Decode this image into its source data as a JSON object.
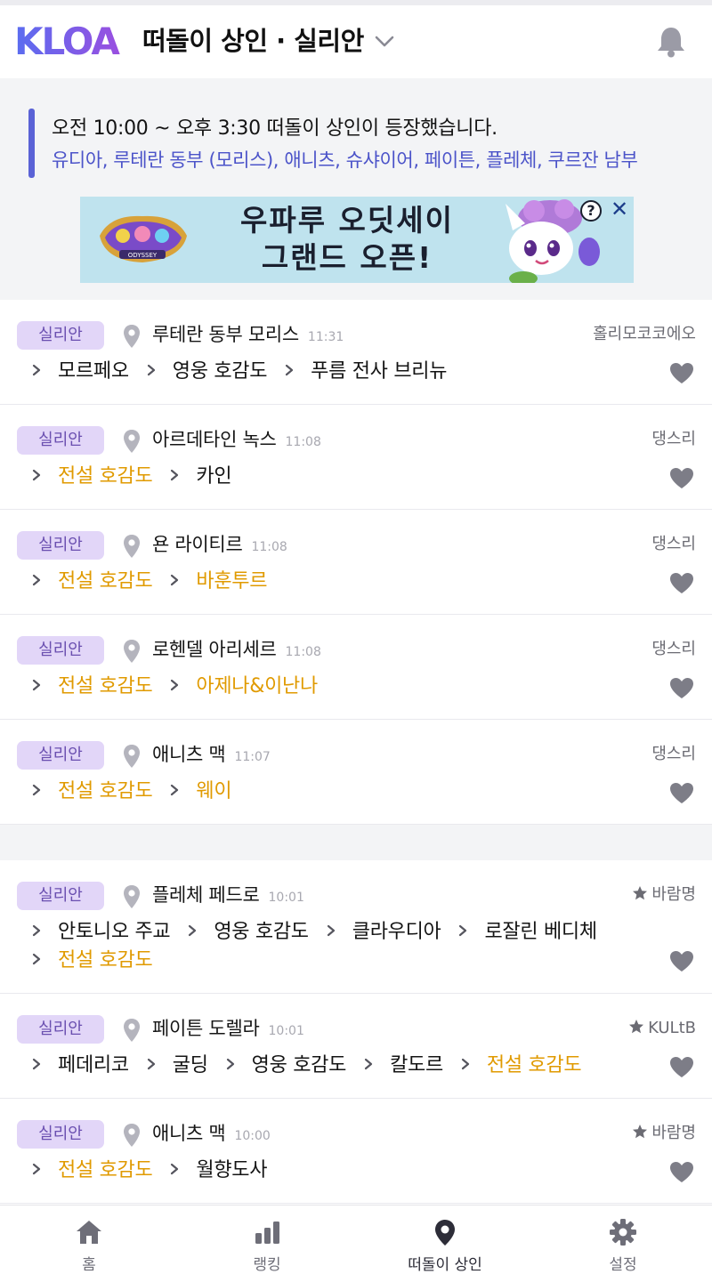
{
  "header": {
    "logo_text": "KLOA",
    "title": "떠돌이 상인 · 실리안",
    "logo_colors": [
      "#5a6df0",
      "#9a4fe0"
    ]
  },
  "notice": {
    "line1": "오전 10:00 ~ 오후 3:30 떠돌이 상인이 등장했습니다.",
    "line2": "유디아, 루테란 동부 (모리스), 애니츠, 슈샤이어, 페이튼, 플레체, 쿠르잔 남부"
  },
  "ad": {
    "text_line1": "우파루 오딧세이",
    "text_line2": "그랜드 오픈!",
    "info_label": "?",
    "close_label": "✕",
    "game_logo_text": "ODYSSEY"
  },
  "colors": {
    "accent": "#5a62d6",
    "badge_bg": "#e2d6f8",
    "badge_text": "#6a4fb0",
    "gold_item": "#e09a00",
    "icon_gray": "#9b9ba6"
  },
  "merchants_recent": [
    {
      "server": "실리안",
      "location": "루테란 동부 모리스",
      "time": "11:31",
      "user": "홀리모코코에오",
      "starred": false,
      "route": [
        {
          "name": "모르페오",
          "legendary": false
        },
        {
          "name": "영웅 호감도",
          "legendary": false
        },
        {
          "name": "푸름 전사 브리뉴",
          "legendary": false
        }
      ]
    },
    {
      "server": "실리안",
      "location": "아르데타인 녹스",
      "time": "11:08",
      "user": "댕스리",
      "starred": false,
      "route": [
        {
          "name": "전설 호감도",
          "legendary": true
        },
        {
          "name": "카인",
          "legendary": false
        }
      ]
    },
    {
      "server": "실리안",
      "location": "욘 라이티르",
      "time": "11:08",
      "user": "댕스리",
      "starred": false,
      "route": [
        {
          "name": "전설 호감도",
          "legendary": true
        },
        {
          "name": "바훈투르",
          "legendary": true
        }
      ]
    },
    {
      "server": "실리안",
      "location": "로헨델 아리세르",
      "time": "11:08",
      "user": "댕스리",
      "starred": false,
      "route": [
        {
          "name": "전설 호감도",
          "legendary": true
        },
        {
          "name": "아제나&이난나",
          "legendary": true
        }
      ]
    },
    {
      "server": "실리안",
      "location": "애니츠 맥",
      "time": "11:07",
      "user": "댕스리",
      "starred": false,
      "route": [
        {
          "name": "전설 호감도",
          "legendary": true
        },
        {
          "name": "웨이",
          "legendary": true
        }
      ]
    }
  ],
  "merchants_earlier": [
    {
      "server": "실리안",
      "location": "플레체 페드로",
      "time": "10:01",
      "user": "바람명",
      "starred": true,
      "route": [
        {
          "name": "안토니오 주교",
          "legendary": false
        },
        {
          "name": "영웅 호감도",
          "legendary": false
        },
        {
          "name": "클라우디아",
          "legendary": false
        },
        {
          "name": "로잘린 베디체",
          "legendary": false
        },
        {
          "name": "전설 호감도",
          "legendary": true
        }
      ]
    },
    {
      "server": "실리안",
      "location": "페이튼 도렐라",
      "time": "10:01",
      "user": "KULtB",
      "starred": true,
      "route": [
        {
          "name": "페데리코",
          "legendary": false
        },
        {
          "name": "굴딩",
          "legendary": false
        },
        {
          "name": "영웅 호감도",
          "legendary": false
        },
        {
          "name": "칼도르",
          "legendary": false
        },
        {
          "name": "전설 호감도",
          "legendary": true
        }
      ]
    },
    {
      "server": "실리안",
      "location": "애니츠 맥",
      "time": "10:00",
      "user": "바람명",
      "starred": true,
      "route": [
        {
          "name": "전설 호감도",
          "legendary": true
        },
        {
          "name": "월향도사",
          "legendary": false
        }
      ]
    }
  ],
  "bottom_nav": [
    {
      "label": "홈",
      "icon": "home-icon",
      "active": false
    },
    {
      "label": "랭킹",
      "icon": "bar-chart-icon",
      "active": false
    },
    {
      "label": "떠돌이 상인",
      "icon": "map-pin-icon",
      "active": true
    },
    {
      "label": "설정",
      "icon": "gear-icon",
      "active": false
    }
  ]
}
